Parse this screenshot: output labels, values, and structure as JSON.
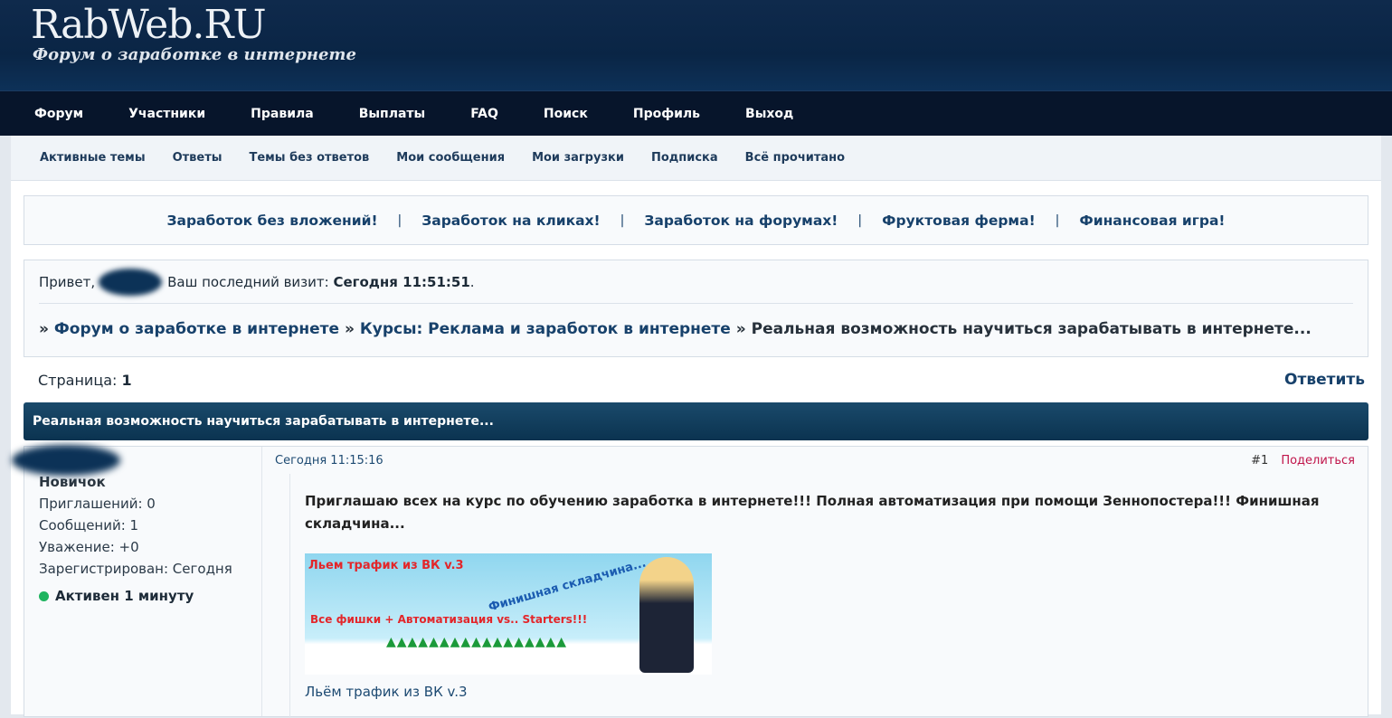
{
  "header": {
    "logo": "RabWeb.RU",
    "tagline": "Форум о заработке в интернете"
  },
  "nav": [
    "Форум",
    "Участники",
    "Правила",
    "Выплаты",
    "FAQ",
    "Поиск",
    "Профиль",
    "Выход"
  ],
  "subnav": [
    "Активные темы",
    "Ответы",
    "Темы без ответов",
    "Мои сообщения",
    "Мои загрузки",
    "Подписка",
    "Всё прочитано"
  ],
  "promo": {
    "links": [
      "Заработок без вложений!",
      "Заработок на кликах!",
      "Заработок на форумах!",
      "Фруктовая ферма!",
      "Финансовая игра!"
    ],
    "sep": "|"
  },
  "welcome": {
    "hello": "Привет,",
    "last_visit_label": "Ваш последний визит:",
    "last_visit": "Сегодня 11:51:51",
    "dot": "."
  },
  "breadcrumbs": {
    "sep": "»",
    "items": [
      "Форум о заработке в интернете",
      "Курсы: Реклама и заработок в интернете"
    ],
    "current": "Реальная возможность научиться зарабатывать в интернете..."
  },
  "pagination": {
    "label": "Страница:",
    "page": "1",
    "reply": "Ответить"
  },
  "topic_title": "Реальная возможность научиться зарабатывать в интернете...",
  "post": {
    "author": {
      "rank": "Новичок",
      "invites": "Приглашений: 0",
      "messages": "Сообщений: 1",
      "respect": "Уважение: +0",
      "registered": "Зарегистрирован: Сегодня",
      "active": "Активен 1 минуту"
    },
    "date": "Сегодня 11:15:16",
    "number": "#1",
    "share": "Поделиться",
    "text": "Приглашаю всех на курс по обучению заработка в интернете!!! Полная автоматизация при помощи Зеннопостера!!! Финишная складчина...",
    "banner": {
      "line1": "Льем трафик из ВК v.3",
      "line2": "Финишная складчина...",
      "line3": "Все фишки + Автоматизация vs.. Starters!!!"
    },
    "caption": "Льём трафик из ВК v.3"
  }
}
